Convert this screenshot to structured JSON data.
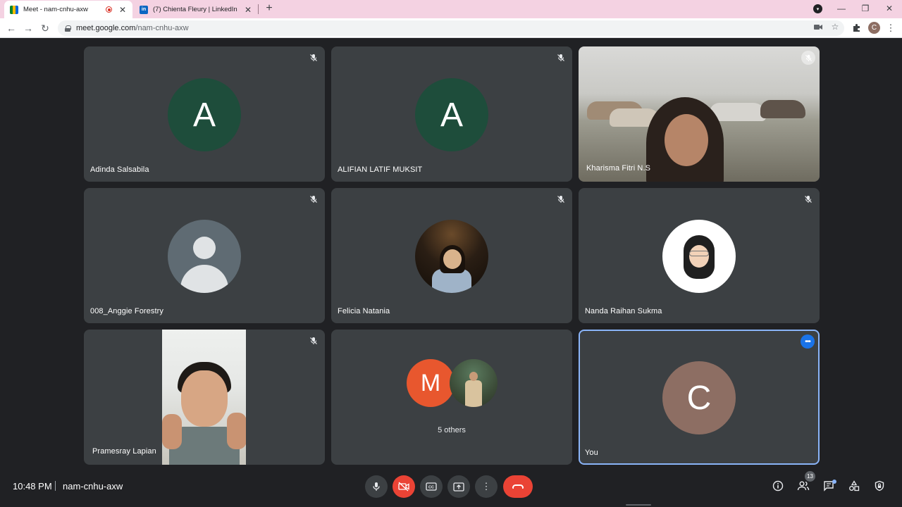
{
  "browser": {
    "tabs": [
      {
        "title": "Meet - nam-cnhu-axw",
        "active": true
      },
      {
        "title": "(7) Chienta Fleury | LinkedIn",
        "active": false
      }
    ],
    "linkedin_favicon_text": "in",
    "address": {
      "host": "meet.google.com",
      "path": "/nam-cnhu-axw"
    },
    "profile_initial": "C",
    "colors": {
      "tabstrip": "#f4d2e2"
    }
  },
  "participants": [
    {
      "name": "Adinda Salsabila",
      "initial": "A",
      "muted": true
    },
    {
      "name": "ALIFIAN LATIF MUKSIT",
      "initial": "A",
      "muted": true
    },
    {
      "name": "Kharisma Fitri N.S",
      "muted": true,
      "video": true
    },
    {
      "name": "008_Anggie Forestry",
      "muted": true
    },
    {
      "name": "Felicia Natania",
      "muted": true
    },
    {
      "name": "Nanda Raihan Sukma",
      "muted": true
    },
    {
      "name": "Pramesray Lapian",
      "muted": true,
      "video": true
    },
    {
      "name": "5 others",
      "initial": "M"
    },
    {
      "name": "You",
      "initial": "C"
    }
  ],
  "bottom_bar": {
    "time": "10:48 PM",
    "meeting_code": "nam-cnhu-axw",
    "people_count": "13"
  },
  "colors": {
    "background": "#202124",
    "tile": "#3c4043",
    "hangup": "#ea4335",
    "you_border": "#8ab4f8",
    "avatar_green": "#1e4d3b",
    "avatar_orange": "#e8572e",
    "avatar_brown": "#8d6e63"
  }
}
